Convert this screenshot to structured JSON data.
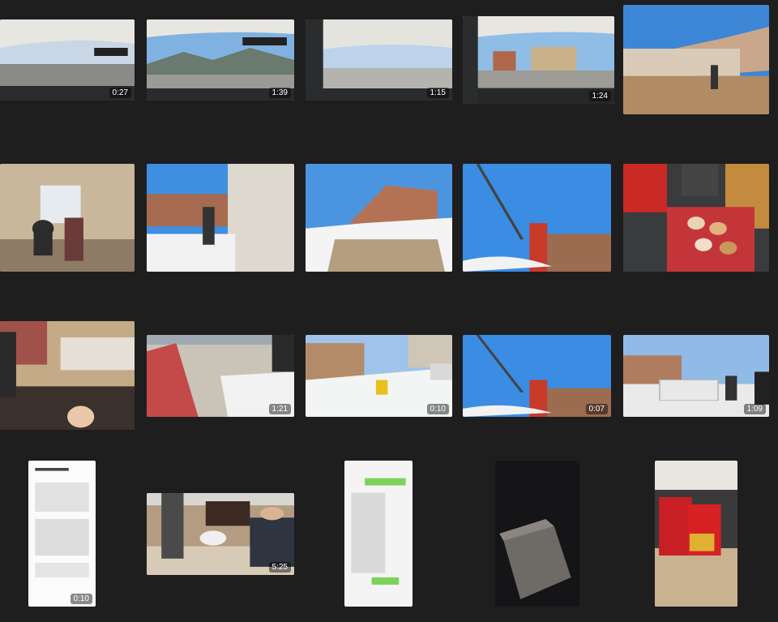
{
  "gallery": {
    "items": [
      {
        "name": "thumb-car-road-1",
        "kind": "video",
        "duration": "0:27",
        "scene": "car-interior"
      },
      {
        "name": "thumb-car-road-2",
        "kind": "video",
        "duration": "1:39",
        "scene": "car-mountain"
      },
      {
        "name": "thumb-car-road-3",
        "kind": "video",
        "duration": "1:15",
        "scene": "car-snow"
      },
      {
        "name": "thumb-car-village",
        "kind": "video",
        "duration": "1:24",
        "scene": "car-village",
        "selected": true
      },
      {
        "name": "thumb-courtyard-broom",
        "kind": "photo",
        "duration": "",
        "scene": "courtyard"
      },
      {
        "name": "thumb-room-people",
        "kind": "photo",
        "duration": "",
        "scene": "room"
      },
      {
        "name": "thumb-corridor",
        "kind": "photo",
        "duration": "",
        "scene": "corridor"
      },
      {
        "name": "thumb-snow-wall",
        "kind": "photo",
        "duration": "",
        "scene": "snow-wall"
      },
      {
        "name": "thumb-gate-sky",
        "kind": "photo",
        "duration": "",
        "scene": "gate-sky"
      },
      {
        "name": "thumb-food-table",
        "kind": "photo",
        "duration": "",
        "scene": "food"
      },
      {
        "name": "thumb-sofa-room",
        "kind": "photo",
        "duration": "",
        "scene": "sofa"
      },
      {
        "name": "thumb-yard-snow",
        "kind": "video",
        "duration": "1:21",
        "scene": "yard"
      },
      {
        "name": "thumb-shoveling-snow",
        "kind": "video",
        "duration": "0:10",
        "scene": "shovel"
      },
      {
        "name": "thumb-gate-video",
        "kind": "video",
        "duration": "0:07",
        "scene": "gate-sky"
      },
      {
        "name": "thumb-car-people",
        "kind": "video",
        "duration": "1:09",
        "scene": "car-people"
      },
      {
        "name": "thumb-document-screenshot",
        "kind": "video",
        "duration": "0:10",
        "scene": "doc"
      },
      {
        "name": "thumb-dog-room",
        "kind": "video",
        "duration": "5:25",
        "scene": "dog"
      },
      {
        "name": "thumb-chat-screenshot",
        "kind": "photo",
        "duration": "",
        "scene": "chat"
      },
      {
        "name": "thumb-dark-box",
        "kind": "photo",
        "duration": "",
        "scene": "dark"
      },
      {
        "name": "thumb-gift-boxes",
        "kind": "photo",
        "duration": "",
        "scene": "gifts"
      }
    ]
  }
}
